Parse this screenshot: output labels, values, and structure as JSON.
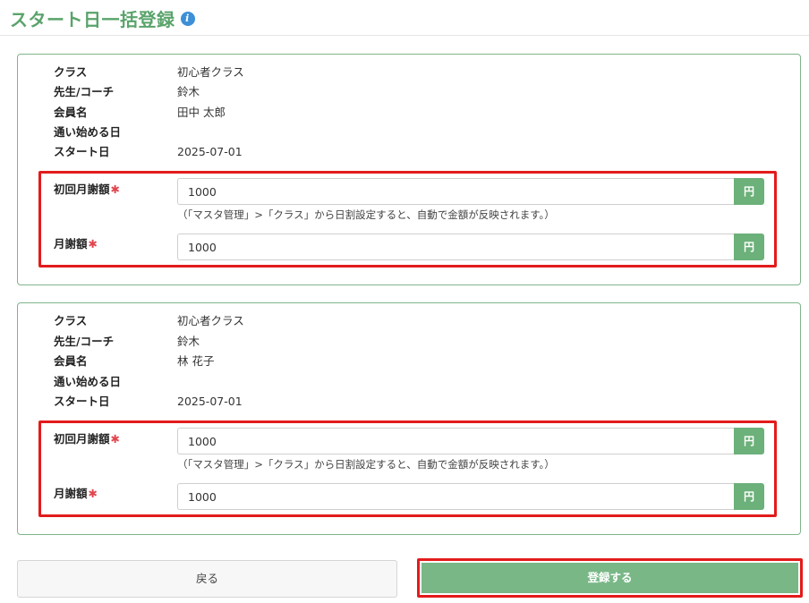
{
  "page": {
    "title": "スタート日一括登録",
    "info_icon": "i"
  },
  "entries": [
    {
      "info": [
        {
          "label": "クラス",
          "value": "初心者クラス"
        },
        {
          "label": "先生/コーチ",
          "value": "鈴木"
        },
        {
          "label": "会員名",
          "value": "田中 太郎"
        },
        {
          "label": "通い始める日",
          "value": ""
        },
        {
          "label": "スタート日",
          "value": "2025-07-01"
        }
      ],
      "first_fee_label": "初回月謝額",
      "first_fee_value": "1000",
      "monthly_fee_label": "月謝額",
      "monthly_fee_value": "1000",
      "currency": "円",
      "required_mark": "✱",
      "help_text": "（「マスタ管理」>「クラス」から日割設定すると、自動で金額が反映されます。）"
    },
    {
      "info": [
        {
          "label": "クラス",
          "value": "初心者クラス"
        },
        {
          "label": "先生/コーチ",
          "value": "鈴木"
        },
        {
          "label": "会員名",
          "value": "林 花子"
        },
        {
          "label": "通い始める日",
          "value": ""
        },
        {
          "label": "スタート日",
          "value": "2025-07-01"
        }
      ],
      "first_fee_label": "初回月謝額",
      "first_fee_value": "1000",
      "monthly_fee_label": "月謝額",
      "monthly_fee_value": "1000",
      "currency": "円",
      "required_mark": "✱",
      "help_text": "（「マスタ管理」>「クラス」から日割設定すると、自動で金額が反映されます。）"
    }
  ],
  "actions": {
    "back_label": "戻る",
    "register_label": "登録する"
  },
  "colors": {
    "accent": "#5aa36b",
    "button_green": "#79b787",
    "highlight_red": "#e31b1b",
    "required_red": "#e0454e"
  }
}
